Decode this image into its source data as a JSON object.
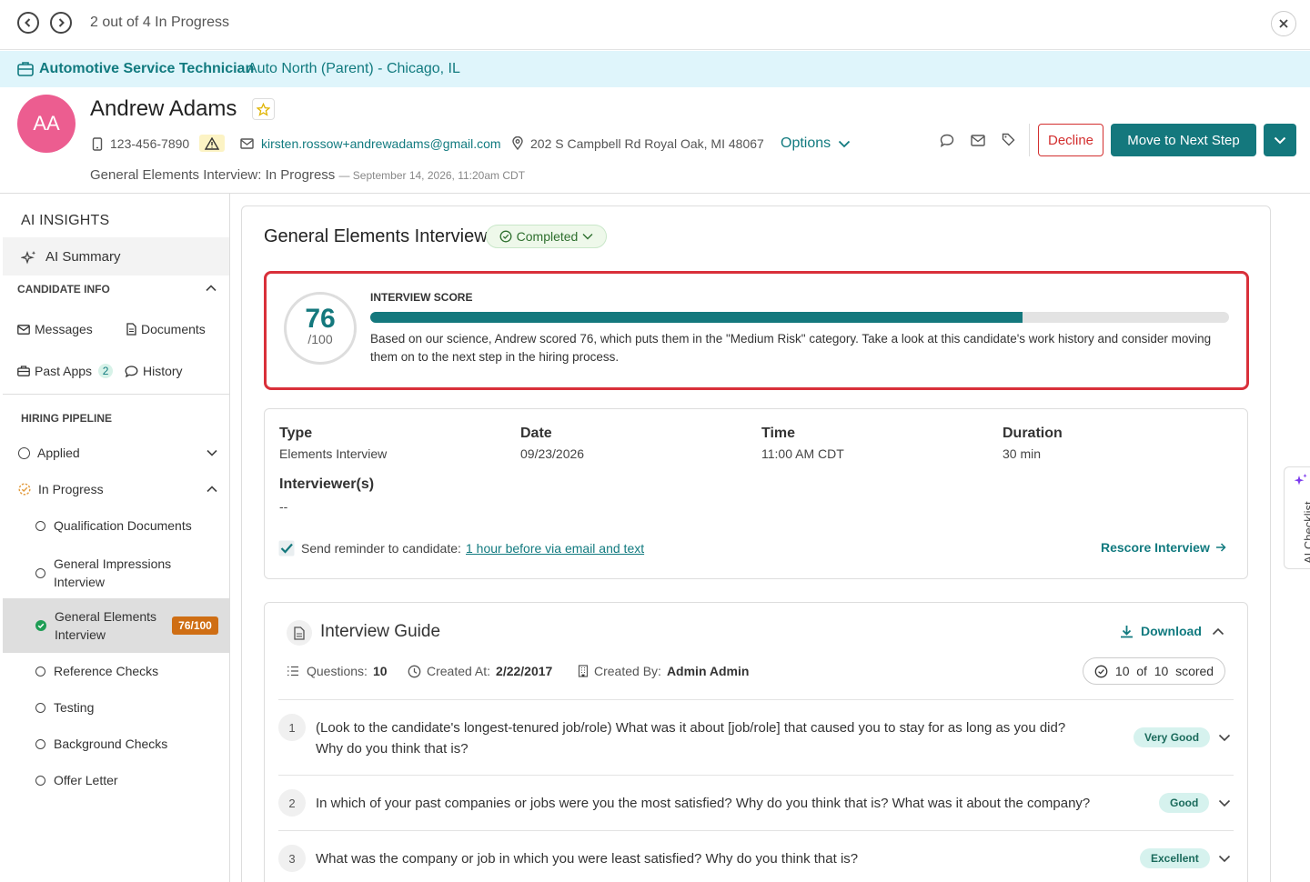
{
  "nav": {
    "counter": "2 out of 4 In Progress"
  },
  "job": {
    "title": "Automotive Service Technician",
    "company": "Auto North (Parent) - Chicago, IL"
  },
  "candidate": {
    "initials": "AA",
    "name": "Andrew Adams",
    "phone": "123-456-7890",
    "email": "kirsten.rossow+andrewadams@gmail.com",
    "address": "202 S Campbell Rd Royal Oak, MI 48067",
    "options_label": "Options",
    "stage": "General Elements Interview: In Progress",
    "stage_timestamp": "— September 14, 2026, 11:20am CDT"
  },
  "actions": {
    "decline": "Decline",
    "next_step": "Move to Next Step"
  },
  "sidebar": {
    "ai_insights": "AI INSIGHTS",
    "ai_summary": "AI Summary",
    "candidate_info": "CANDIDATE INFO",
    "messages": "Messages",
    "documents": "Documents",
    "past_apps": "Past Apps",
    "past_apps_count": "2",
    "history": "History",
    "hiring_pipeline": "HIRING PIPELINE",
    "applied": "Applied",
    "in_progress": "In Progress",
    "steps": [
      {
        "label": "Qualification Documents"
      },
      {
        "label": "General Impressions Interview"
      },
      {
        "label": "General Elements Interview",
        "score": "76/100"
      },
      {
        "label": "Reference Checks"
      },
      {
        "label": "Testing"
      },
      {
        "label": "Background Checks"
      },
      {
        "label": "Offer Letter"
      }
    ]
  },
  "interview": {
    "title": "General Elements Interview",
    "status": "Completed",
    "score_label": "INTERVIEW SCORE",
    "score": "76",
    "score_max": "/100",
    "score_fraction": 0.76,
    "score_text": "Based on our science, Andrew scored 76, which puts them in the \"Medium Risk\" category. Take a look at this candidate's work history and consider moving them on to the next step in the hiring process.",
    "type_label": "Type",
    "type_value": "Elements Interview",
    "date_label": "Date",
    "date_value": "09/23/2026",
    "time_label": "Time",
    "time_value": "11:00 AM CDT",
    "duration_label": "Duration",
    "duration_value": "30 min",
    "interviewers_label": "Interviewer(s)",
    "interviewers_value": "--",
    "reminder_label": "Send reminder to candidate:",
    "reminder_link": "1 hour before via email and text",
    "rescore": "Rescore Interview"
  },
  "guide": {
    "title": "Interview Guide",
    "download": "Download",
    "questions_label": "Questions:",
    "questions_count": "10",
    "created_at_label": "Created At:",
    "created_at": "2/22/2017",
    "created_by_label": "Created By:",
    "created_by": "Admin Admin",
    "scored": "10  of  10  scored",
    "questions": [
      {
        "num": "1",
        "text_line1": "(Look to the candidate's longest-tenured job/role) What was it about [job/role] that caused you to stay for as long as you did?",
        "text_line2": "Why do you think that is?",
        "rating": "Very Good"
      },
      {
        "num": "2",
        "text_line1": "In which of your past companies or jobs were you the most satisfied? Why do you think that is? What was it about the company?",
        "rating": "Good"
      },
      {
        "num": "3",
        "text_line1": "What was the company or job in which you were least satisfied? Why do you think that is?",
        "rating": "Excellent"
      }
    ]
  },
  "ai_checklist": "AI Checklist",
  "colors": {
    "accent": "#14787d",
    "decline": "#d32f2f",
    "avatar": "#ec5d90",
    "score_highlight": "#d9303a"
  }
}
